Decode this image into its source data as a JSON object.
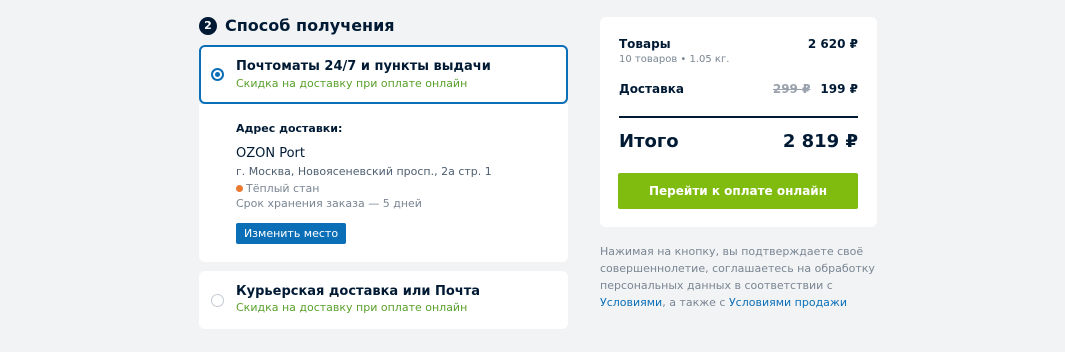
{
  "step": {
    "number": "2",
    "title": "Способ получения"
  },
  "options": [
    {
      "title": "Почтоматы 24/7 и пункты выдачи",
      "subtitle": "Скидка на доставку при оплате онлайн",
      "selected": true
    },
    {
      "title": "Курьерская доставка или Почта",
      "subtitle": "Скидка на доставку при оплате онлайн",
      "selected": false
    }
  ],
  "address": {
    "label": "Адрес доставки:",
    "name": "OZON Port",
    "street": "г. Москва, Новоясеневский просп., 2а стр. 1",
    "metro": "Тёплый стан",
    "storage": "Срок хранения заказа — 5 дней",
    "change_button": "Изменить место"
  },
  "summary": {
    "goods_label": "Товары",
    "goods_value": "2 620 ₽",
    "goods_note": "10 товаров • 1.05 кг.",
    "delivery_label": "Доставка",
    "delivery_old": "299 ₽",
    "delivery_new": "199 ₽",
    "total_label": "Итого",
    "total_value": "2 819 ₽",
    "pay_button": "Перейти к оплате онлайн"
  },
  "legal": {
    "text1": "Нажимая на кнопку, вы подтверждаете своё совершеннолетие, соглашаетесь на обработку персональных данных в соответствии с ",
    "link1": "Условиями",
    "text2": ", а также с ",
    "link2": "Условиями продажи"
  },
  "colors": {
    "accent": "#0b6fb8",
    "pay": "#80bb10",
    "discount": "#5aa02c",
    "metro": "#e8792f"
  }
}
